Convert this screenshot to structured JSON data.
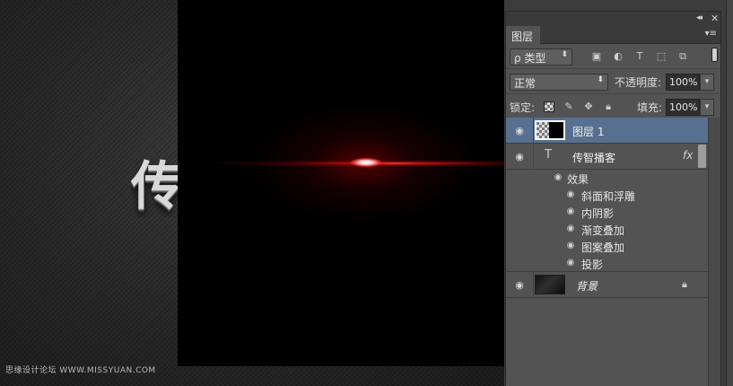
{
  "canvas": {
    "partial_text": "传",
    "watermark": "思缘设计论坛 WWW.MISSYUAN.COM"
  },
  "panel": {
    "title": "图层",
    "filter": {
      "label": "ρ 类型"
    },
    "blend_mode": "正常",
    "opacity": {
      "label": "不透明度:",
      "value": "100%"
    },
    "lock": {
      "label": "锁定:"
    },
    "fill": {
      "label": "填充:",
      "value": "100%"
    },
    "layers": [
      {
        "name": "图层 1",
        "selected": true,
        "kind": "pixel"
      },
      {
        "name": "传智播客",
        "selected": false,
        "kind": "text",
        "fx": "fx"
      },
      {
        "name": "背景",
        "selected": false,
        "kind": "background",
        "locked": true
      }
    ],
    "effects_header": "效果",
    "effects": [
      "斜面和浮雕",
      "内阴影",
      "渐变叠加",
      "图案叠加",
      "投影"
    ]
  },
  "icons": {
    "eye": "eye-icon",
    "text_layer": "T",
    "lock": "lock-icon"
  },
  "colors": {
    "selected_layer": "#58708f",
    "panel_bg": "#535353",
    "flare": "#ff2020"
  }
}
